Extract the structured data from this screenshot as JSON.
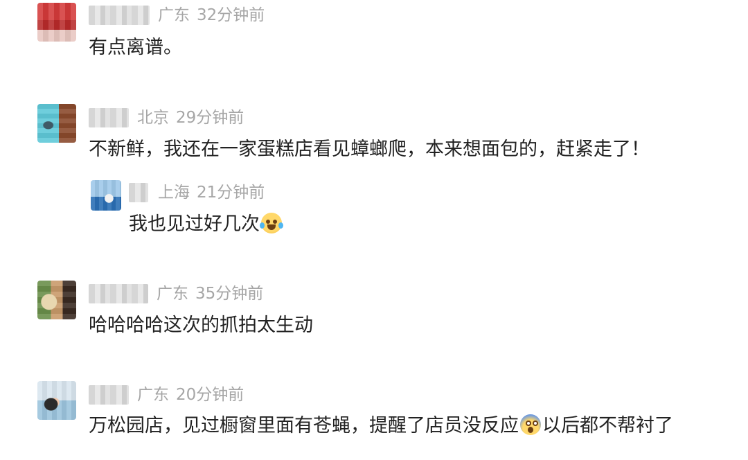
{
  "comments": [
    {
      "location": "广东",
      "time": "32分钟前",
      "text": "有点离谱。"
    },
    {
      "location": "北京",
      "time": "29分钟前",
      "text": "不新鲜，我还在一家蛋糕店看见蟑螂爬，本来想面包的，赶紧走了！",
      "reply": {
        "location": "上海",
        "time": "21分钟前",
        "text": "我也见过好几次",
        "emoji": "face-with-tears-of-joy-icon"
      }
    },
    {
      "location": "广东",
      "time": "35分钟前",
      "text": "哈哈哈哈这次的抓拍太生动"
    },
    {
      "location": "广东",
      "time": "20分钟前",
      "text_before": "万松园店，见过橱窗里面有苍蝇，提醒了店员没反应",
      "emoji": "fearful-face-icon",
      "text_after": "以后都不帮衬了"
    }
  ],
  "colors": {
    "text": "#222222",
    "meta": "#a6a6a6",
    "background": "#ffffff"
  }
}
